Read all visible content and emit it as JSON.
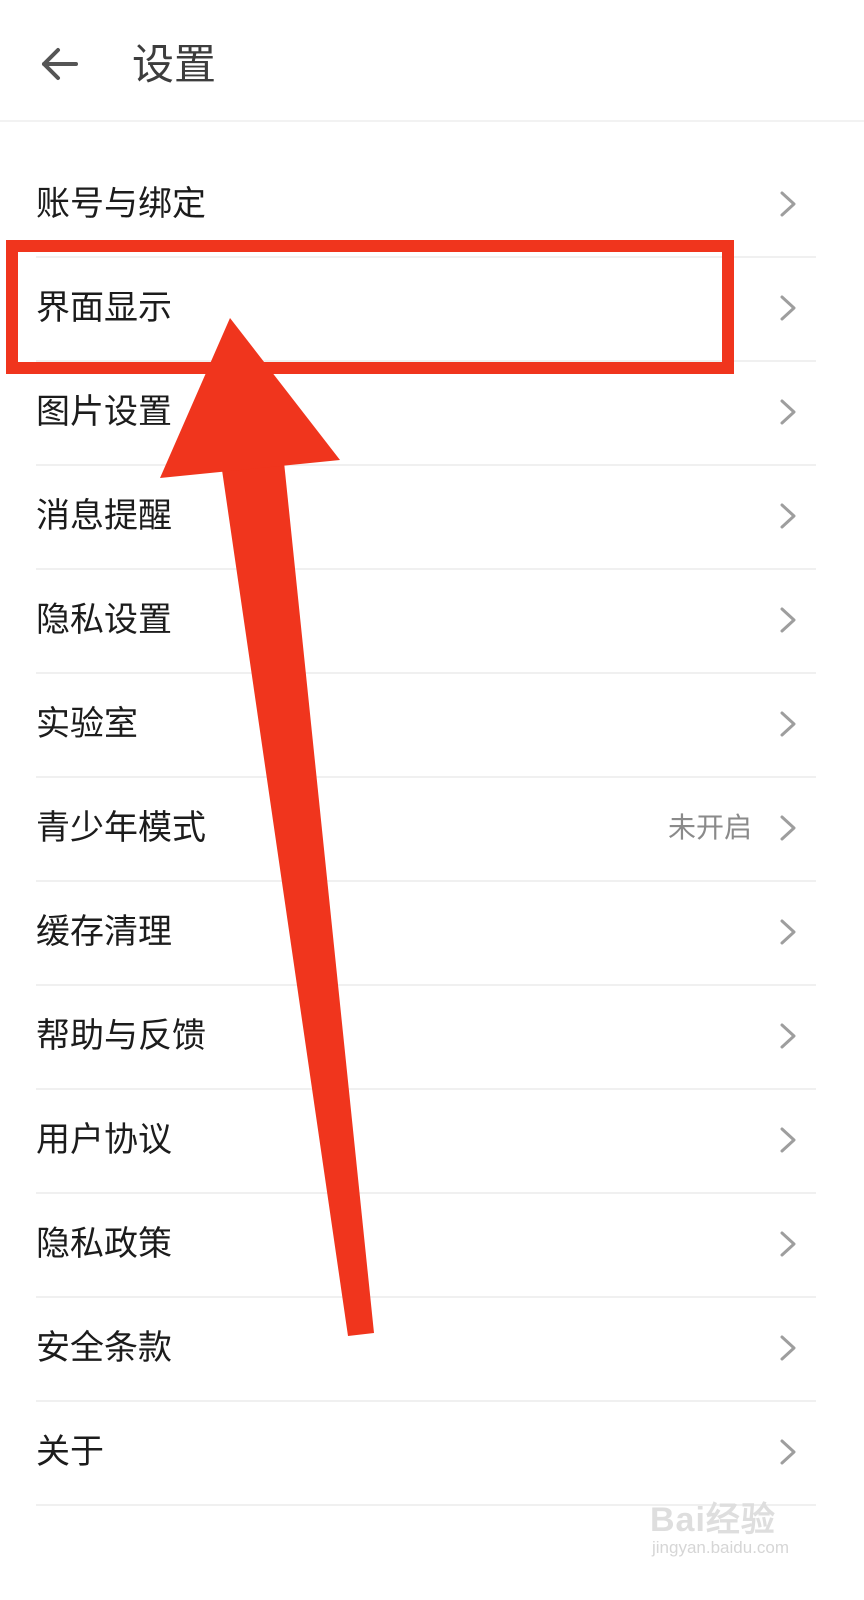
{
  "header": {
    "title": "设置",
    "back_icon": "arrow-left-icon"
  },
  "settings": {
    "items": [
      {
        "label": "账号与绑定",
        "value": ""
      },
      {
        "label": "界面显示",
        "value": ""
      },
      {
        "label": "图片设置",
        "value": ""
      },
      {
        "label": "消息提醒",
        "value": ""
      },
      {
        "label": "隐私设置",
        "value": ""
      },
      {
        "label": "实验室",
        "value": ""
      },
      {
        "label": "青少年模式",
        "value": "未开启"
      },
      {
        "label": "缓存清理",
        "value": ""
      },
      {
        "label": "帮助与反馈",
        "value": ""
      },
      {
        "label": "用户协议",
        "value": ""
      },
      {
        "label": "隐私政策",
        "value": ""
      },
      {
        "label": "安全条款",
        "value": ""
      },
      {
        "label": "关于",
        "value": ""
      }
    ],
    "chevron_icon": "chevron-right-icon"
  },
  "annotation": {
    "highlight_color": "#f0351d",
    "highlight_target": "界面显示",
    "arrow_icon": "arrow-up-icon"
  },
  "watermark": {
    "brand": "Bai经验",
    "url": "jingyan.baidu.com"
  }
}
